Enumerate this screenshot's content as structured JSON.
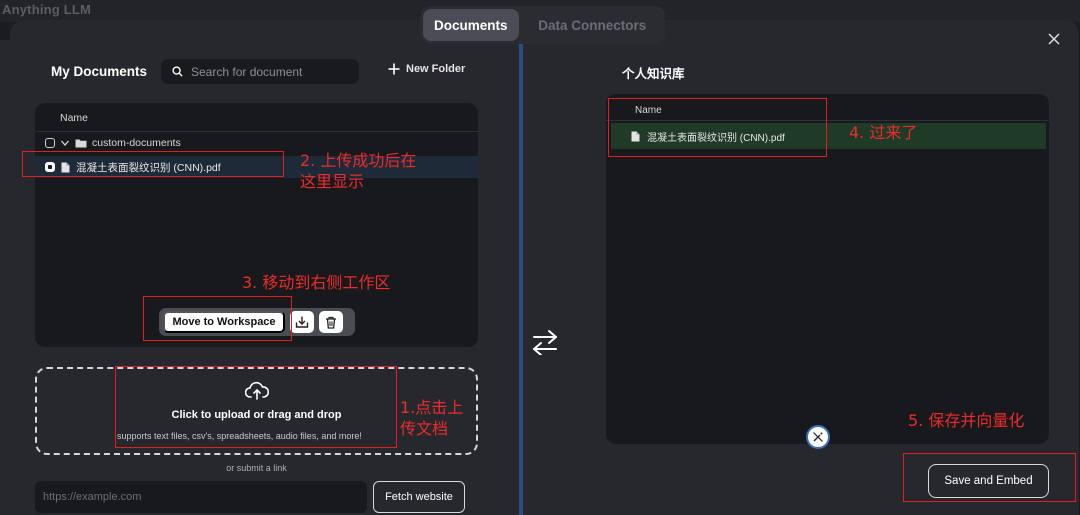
{
  "app": {
    "title": "Anything LLM"
  },
  "tabs": [
    {
      "label": "Documents",
      "active": true
    },
    {
      "label": "Data Connectors",
      "active": false
    }
  ],
  "left": {
    "title": "My Documents",
    "search_placeholder": "Search for document",
    "new_folder_label": "New Folder",
    "list": {
      "header": "Name",
      "folder": "custom-documents",
      "file": "混凝土表面裂纹识别 (CNN).pdf"
    },
    "actions": {
      "move_label": "Move to Workspace"
    },
    "upload": {
      "title": "Click to upload or drag and drop",
      "subtitle": "supports text files, csv's, spreadsheets, audio files, and more!",
      "or_link": "or submit a link",
      "url_placeholder": "https://example.com",
      "fetch_label": "Fetch website"
    }
  },
  "right": {
    "title": "个人知识库",
    "list": {
      "header": "Name",
      "file": "混凝土表面裂纹识别 (CNN).pdf"
    },
    "save_label": "Save and Embed"
  },
  "annotations": {
    "step1": "1.点击上传文档",
    "step2": "2. 上传成功后在这里显示",
    "step3": "3. 移动到右侧工作区",
    "step4": "4. 过来了",
    "step5": "5. 保存并向量化"
  },
  "colors": {
    "accent_divider": "#2a4d82",
    "annotation": "#ee2b2b",
    "selected_row": "#1e2a38",
    "workspace_row": "#1f3a26"
  }
}
